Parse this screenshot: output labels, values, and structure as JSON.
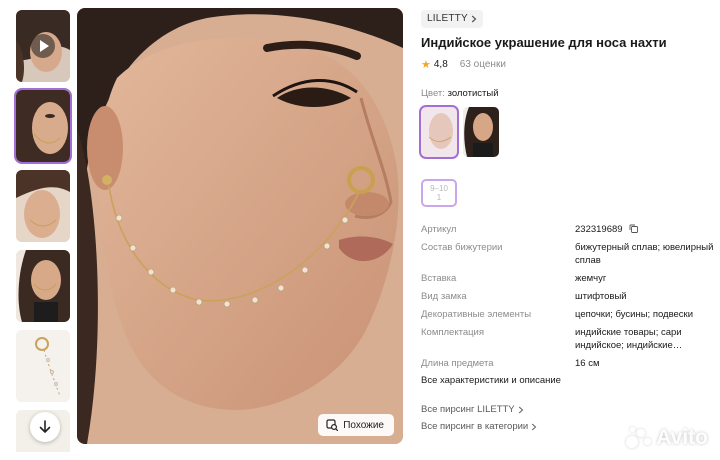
{
  "brand": {
    "name": "LILETTY"
  },
  "product": {
    "title": "Индийское украшение для носа нахти",
    "rating": "4,8",
    "reviews": "63 оценки"
  },
  "color": {
    "label": "Цвет:",
    "value": "золотистый"
  },
  "size": {
    "line1": "9–10",
    "line2": "1"
  },
  "similar_button": {
    "label": "Похожие"
  },
  "specs": [
    {
      "key": "Артикул",
      "value": "232319689"
    },
    {
      "key": "Состав бижутерии",
      "value": "бижутерный сплав; ювелирный сплав"
    },
    {
      "key": "Вставка",
      "value": "жемчуг"
    },
    {
      "key": "Вид замка",
      "value": "штифтовый"
    },
    {
      "key": "Декоративные элементы",
      "value": "цепочки; бусины; подвески"
    },
    {
      "key": "Комплектация",
      "value": "индийские товары; сари индийское; индийские…"
    },
    {
      "key": "Длина предмета",
      "value": "16 см"
    }
  ],
  "links": {
    "all_characteristics": "Все характеристики и описание",
    "all_brand": "Все пирсинг LILETTY",
    "all_category": "Все пирсинг в категории"
  },
  "watermark": {
    "text": "Avito"
  },
  "icons": {
    "brand_chevron": "chevron-right-icon",
    "star": "star-icon",
    "copy": "copy-icon",
    "play": "play-icon",
    "arrow_down": "arrow-down-icon",
    "similar": "image-search-icon"
  },
  "colors": {
    "accent": "#a26fd6",
    "star": "#f5a623",
    "muted_text": "#8c8c8c"
  }
}
